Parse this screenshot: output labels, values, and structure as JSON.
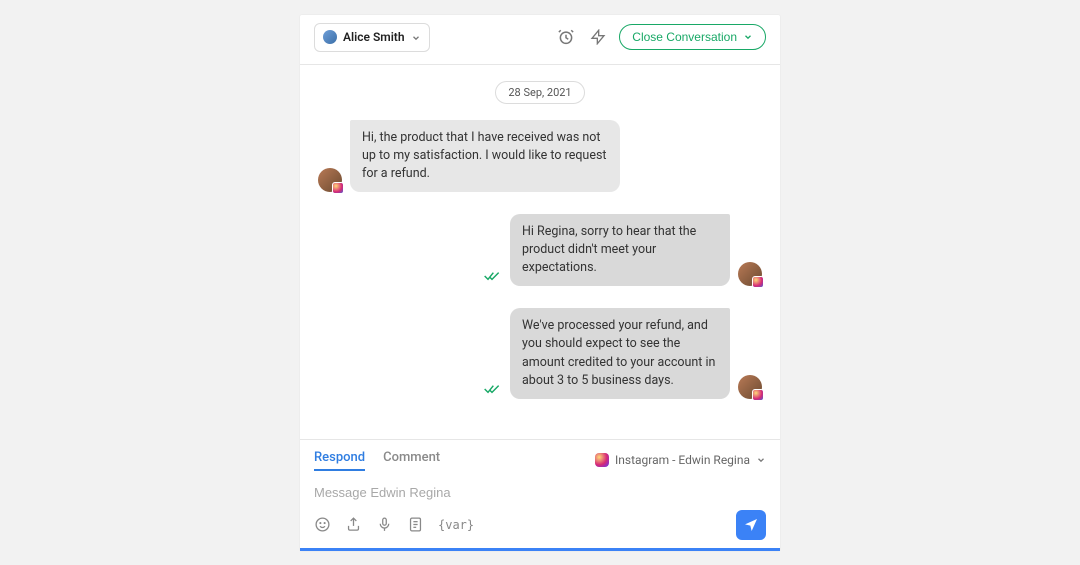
{
  "header": {
    "assignee_name": "Alice Smith",
    "close_label": "Close Conversation"
  },
  "conversation": {
    "date_label": "28 Sep, 2021",
    "messages": [
      {
        "direction": "in",
        "text": "Hi, the product that I have received was not up to my satisfaction. I would like to request for a refund."
      },
      {
        "direction": "out",
        "text": "Hi Regina, sorry to hear that the product didn't meet your expectations."
      },
      {
        "direction": "out",
        "text": "We've processed your refund, and you should expect to see the amount credited to your account in about 3 to 5 business days."
      }
    ]
  },
  "composer": {
    "tabs": {
      "respond": "Respond",
      "comment": "Comment"
    },
    "channel_label": "Instagram - Edwin Regina",
    "placeholder": "Message Edwin Regina",
    "variable_token": "{var}"
  }
}
